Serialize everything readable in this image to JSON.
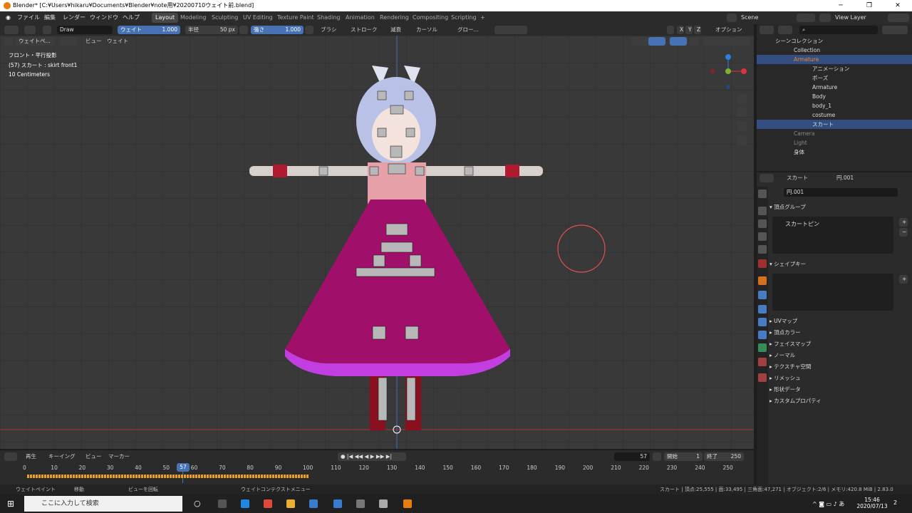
{
  "window": {
    "title": "Blender* [C:¥Users¥hikaru¥Documents¥Blender¥note用¥20200710ウェイト前.blend]"
  },
  "menus": [
    "ファイル",
    "編集",
    "レンダー",
    "ウィンドウ",
    "ヘルプ"
  ],
  "workspaces": [
    "Layout",
    "Modeling",
    "Sculpting",
    "UV Editing",
    "Texture Paint",
    "Shading",
    "Animation",
    "Rendering",
    "Compositing",
    "Scripting"
  ],
  "scene": "Scene",
  "view_layer": "View Layer",
  "tool": {
    "brush": "Draw",
    "weight_label": "ウェイト",
    "weight": "1.000",
    "radius_label": "半径",
    "radius": "50 px",
    "strength_label": "強さ",
    "strength": "1.000",
    "menus": [
      "ブラシ",
      "ストローク",
      "減衰",
      "カーソル",
      "グロー..."
    ],
    "axes": [
      "X",
      "Y",
      "Z"
    ],
    "options": "オプション"
  },
  "vp": {
    "mode": "ウェイトペ...",
    "view": "ビュー",
    "weights": "ウェイト",
    "line1": "フロント・平行投影",
    "line2": "(57) スカート : skirt front1",
    "line3": "10 Centimeters"
  },
  "outliner": {
    "root": "シーンコレクション",
    "rows": [
      "Collection",
      "Armature",
      "アニメーション",
      "ポーズ",
      "Armature",
      "Body",
      "body_1",
      "costume",
      "スカート",
      "Camera",
      "Light",
      "身体"
    ]
  },
  "props": {
    "object": "スカート",
    "mesh": "円.001",
    "mesh_field": "円.001",
    "vgroups": "頂点グループ",
    "vgroup_item": "スカートピン",
    "shapekeys": "シェイプキー",
    "panels": [
      "UVマップ",
      "頂点カラー",
      "フェイスマップ",
      "ノーマル",
      "テクスチャ空間",
      "リメッシュ",
      "形状データ",
      "カスタムプロパティ"
    ]
  },
  "timeline": {
    "menus": [
      "再生",
      "キーイング",
      "ビュー",
      "マーカー"
    ],
    "frame": "57",
    "start_label": "開始",
    "start": "1",
    "end_label": "終了",
    "end": "250",
    "ticks": [
      "0",
      "10",
      "20",
      "30",
      "40",
      "50",
      "60",
      "70",
      "80",
      "90",
      "100",
      "110",
      "120",
      "130",
      "140",
      "150",
      "160",
      "170",
      "180",
      "190",
      "200",
      "210",
      "220",
      "230",
      "240",
      "250"
    ],
    "current": "57"
  },
  "status": {
    "s1": "ウェイトペイント",
    "s2": "移動",
    "s3": "ビューを回転",
    "s4": "ウェイトコンテクストメニュー",
    "right": "スカート | 頂点:25,555 | 面:33,495 | 三角面:47,271 | オブジェクト:2/6 | メモリ:420.8 MiB | 2.83.0"
  },
  "taskbar": {
    "search": "ここに入力して検索",
    "time": "15:46",
    "date": "2020/07/13",
    "notif": "2"
  }
}
